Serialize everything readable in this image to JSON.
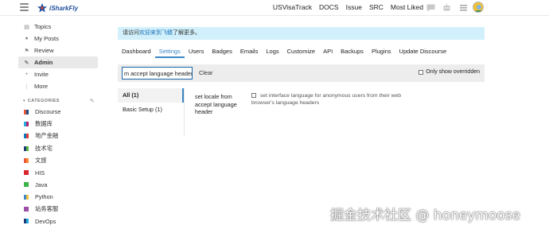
{
  "header": {
    "logo_text": "iSharkFly",
    "links": [
      "USVisaTrack",
      "DOCS",
      "Issue",
      "SRC",
      "Most Liked"
    ]
  },
  "sidebar": {
    "items": [
      {
        "label": "Topics",
        "icon": "topics-icon"
      },
      {
        "label": "My Posts",
        "icon": "user-icon"
      },
      {
        "label": "Review",
        "icon": "flag-icon"
      },
      {
        "label": "Admin",
        "icon": "wrench-icon"
      },
      {
        "label": "Invite",
        "icon": "user-plus-icon"
      },
      {
        "label": "More",
        "icon": "more-icon"
      }
    ],
    "categories_heading": "CATEGORIES",
    "categories": [
      {
        "label": "Discourse",
        "color1": "#e45735",
        "color2": "#1f4d8f"
      },
      {
        "label": "数据库",
        "color1": "#25aae2",
        "color2": "#b3256a"
      },
      {
        "label": "地产金融",
        "color1": "#0e76bd",
        "color2": "#e04030"
      },
      {
        "label": "技术宅",
        "color1": "#1b3c75",
        "color2": "#5cba47"
      },
      {
        "label": "文旅",
        "color1": "#e45735",
        "color2": "#ff8a35"
      },
      {
        "label": "HIS",
        "color1": "#d8262d",
        "color2": "#d8262d"
      },
      {
        "label": "Java",
        "color1": "#3ab54a",
        "color2": "#3ab54a"
      },
      {
        "label": "Python",
        "color1": "#3b86c4",
        "color2": "#f3c443"
      },
      {
        "label": "站务客服",
        "color1": "#9c4fa4",
        "color2": "#9c4fa4"
      },
      {
        "label": "DevOps",
        "color1": "#1b3c75",
        "color2": "#25aae2"
      }
    ]
  },
  "banner": {
    "prefix": "请访问",
    "link": "欢迎来到飞鳍",
    "suffix": "了解更多。"
  },
  "tabs": [
    "Dashboard",
    "Settings",
    "Users",
    "Badges",
    "Emails",
    "Logs",
    "Customize",
    "API",
    "Backups",
    "Plugins",
    "Update Discourse"
  ],
  "active_tab": "Settings",
  "toolbar": {
    "search_value": "m accept language header",
    "clear_label": "Clear",
    "only_overridden_label": "Only show overridden"
  },
  "filters": [
    {
      "label": "All (1)",
      "active": true
    },
    {
      "label": "Basic Setup (1)",
      "active": false
    }
  ],
  "setting": {
    "name": "set locale from accept language header",
    "description": "set interface language for anonymous users from their web browser's language headers"
  },
  "watermark": "掘金技术社区 @ honeymoose",
  "colors": {
    "accent": "#3b86c4",
    "banner_bg": "#d1f0fb",
    "link": "#1a6fb5"
  }
}
